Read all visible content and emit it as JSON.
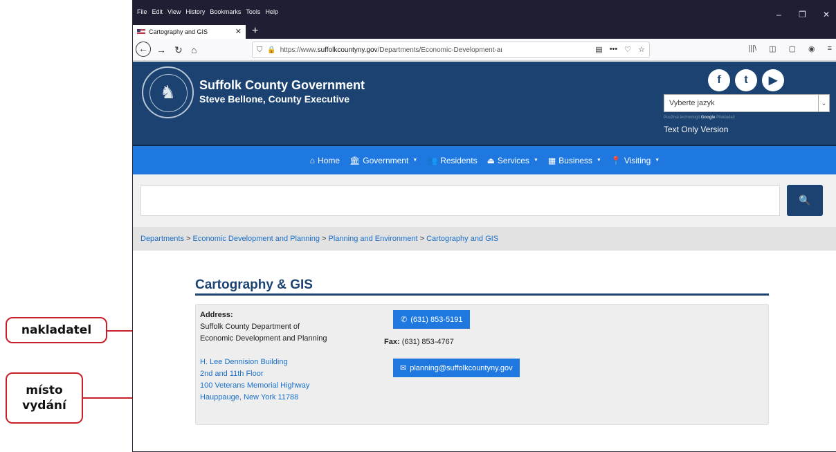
{
  "annotations": {
    "publisher": "nakladatel",
    "place_line1": "místo",
    "place_line2": "vydání"
  },
  "browser": {
    "menu": [
      "File",
      "Edit",
      "View",
      "History",
      "Bookmarks",
      "Tools",
      "Help"
    ],
    "tab_title": "Cartography and GIS",
    "url_prefix": "https://www.",
    "url_domain": "suffolkcountyny.gov",
    "url_path": "/Departments/Economic-Development-and-Planning/Planning-and-Environ",
    "url_menu": "•••"
  },
  "header": {
    "title": "Suffolk County Government",
    "subtitle": "Steve Bellone, County Executive",
    "social": [
      "f",
      "t",
      "▶"
    ],
    "language_select": "Vyberte jazyk",
    "powered_by": "Používá technologii",
    "powered_brand": "Google",
    "powered_service": "Překladač",
    "text_only": "Text Only Version"
  },
  "nav": [
    {
      "icon": "home-icon",
      "glyph": "⌂",
      "label": "Home",
      "caret": false
    },
    {
      "icon": "government-icon",
      "glyph": "🏛",
      "label": "Government",
      "caret": true
    },
    {
      "icon": "residents-icon",
      "glyph": "👥",
      "label": "Residents",
      "caret": false
    },
    {
      "icon": "services-icon",
      "glyph": "⏏",
      "label": "Services",
      "caret": true
    },
    {
      "icon": "business-icon",
      "glyph": "▦",
      "label": "Business",
      "caret": true
    },
    {
      "icon": "visiting-icon",
      "glyph": "📍",
      "label": "Visiting",
      "caret": true
    }
  ],
  "search": {
    "placeholder": "",
    "button_glyph": "🔍"
  },
  "breadcrumb": {
    "items": [
      "Departments",
      "Economic Development and Planning",
      "Planning and Environment",
      "Cartography and GIS"
    ],
    "separator": " > "
  },
  "content": {
    "title": "Cartography & GIS",
    "address_label": "Address:",
    "org_line1": "Suffolk County Department of",
    "org_line2": "Economic Development and Planning",
    "address_lines": [
      "H. Lee Dennision Building",
      "2nd and 11th Floor",
      "100 Veterans Memorial Highway",
      "Hauppauge, New York 11788"
    ],
    "phone": "(631) 853-5191",
    "fax_label": "Fax:",
    "fax": "(631) 853-4767",
    "email": "planning@suffolkcountyny.gov"
  },
  "colors": {
    "accent": "#c8202a",
    "header": "#1b4270",
    "nav": "#1e78e0",
    "link": "#1a6fc9"
  }
}
